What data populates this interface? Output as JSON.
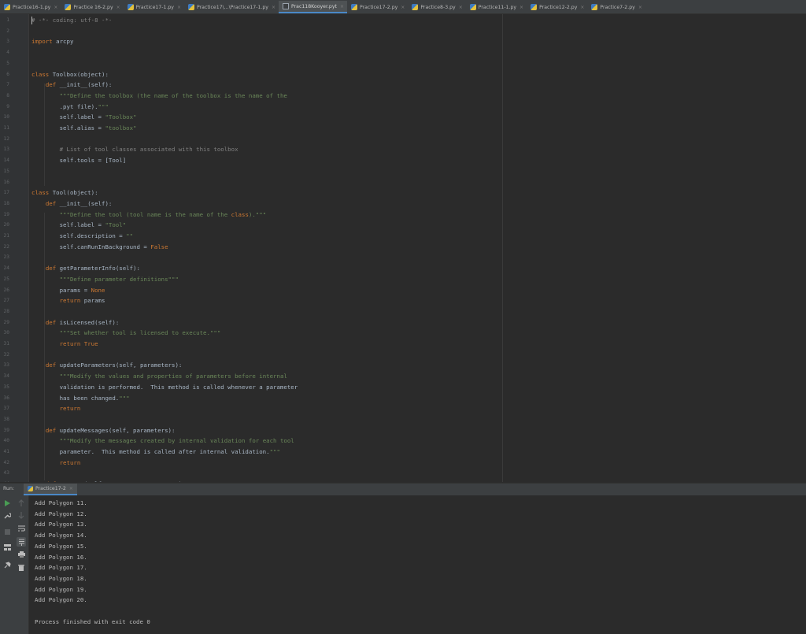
{
  "tabs": [
    {
      "label": "Practice16-1.py",
      "icon": "python-file-icon",
      "active": false
    },
    {
      "label": "Practice 16-2.py",
      "icon": "python-file-icon",
      "active": false
    },
    {
      "label": "Practice17-1.py",
      "icon": "python-file-icon",
      "active": false
    },
    {
      "label": "Practice17\\...\\Practice17-1.py",
      "icon": "python-file-icon",
      "active": false
    },
    {
      "label": "Prac118Kooyer.pyt",
      "icon": "pyt-file-icon",
      "active": true
    },
    {
      "label": "Practice17-2.py",
      "icon": "python-file-icon",
      "active": false
    },
    {
      "label": "Practice8-3.py",
      "icon": "python-file-icon",
      "active": false
    },
    {
      "label": "Practice11-1.py",
      "icon": "python-file-icon",
      "active": false
    },
    {
      "label": "Practice12-2.py",
      "icon": "python-file-icon",
      "active": false
    },
    {
      "label": "Practice7-2.py",
      "icon": "python-file-icon",
      "active": false
    }
  ],
  "tab_close_glyph": "×",
  "editor": {
    "lines": [
      "# -*- coding: utf-8 -*-",
      "",
      "import arcpy",
      "",
      "",
      "class Toolbox(object):",
      "    def __init__(self):",
      "        \"\"\"Define the toolbox (the name of the toolbox is the name of the",
      "        .pyt file).\"\"\"",
      "        self.label = \"Toolbox\"",
      "        self.alias = \"toolbox\"",
      "",
      "        # List of tool classes associated with this toolbox",
      "        self.tools = [Tool]",
      "",
      "",
      "class Tool(object):",
      "    def __init__(self):",
      "        \"\"\"Define the tool (tool name is the name of the class).\"\"\"",
      "        self.label = \"Tool\"",
      "        self.description = \"\"",
      "        self.canRunInBackground = False",
      "",
      "    def getParameterInfo(self):",
      "        \"\"\"Define parameter definitions\"\"\"",
      "        params = None",
      "        return params",
      "",
      "    def isLicensed(self):",
      "        \"\"\"Set whether tool is licensed to execute.\"\"\"",
      "        return True",
      "",
      "    def updateParameters(self, parameters):",
      "        \"\"\"Modify the values and properties of parameters before internal",
      "        validation is performed.  This method is called whenever a parameter",
      "        has been changed.\"\"\"",
      "        return",
      "",
      "    def updateMessages(self, parameters):",
      "        \"\"\"Modify the messages created by internal validation for each tool",
      "        parameter.  This method is called after internal validation.\"\"\"",
      "        return",
      "",
      "    def execute(self, parameters, messages):"
    ]
  },
  "run": {
    "label": "Run:",
    "tab_label": "Practice17-2",
    "tab_icon": "python-file-icon",
    "output": [
      "Add Polygon 11.",
      "Add Polygon 12.",
      "Add Polygon 13.",
      "Add Polygon 14.",
      "Add Polygon 15.",
      "Add Polygon 16.",
      "Add Polygon 17.",
      "Add Polygon 18.",
      "Add Polygon 19.",
      "Add Polygon 20.",
      "",
      "Process finished with exit code 0"
    ]
  },
  "colors": {
    "accent": "#4a88c7",
    "run_green": "#499c54",
    "background": "#2b2b2b",
    "keyword": "#cc7832",
    "string": "#6a8759",
    "comment": "#808080",
    "function": "#ffc66d"
  }
}
